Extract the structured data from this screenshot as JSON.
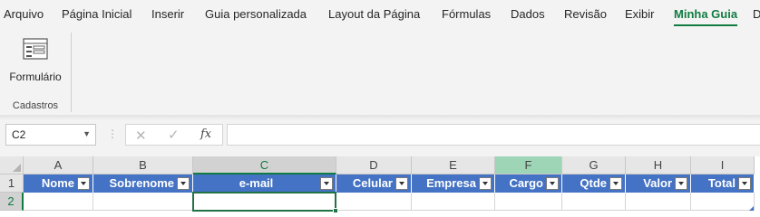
{
  "ribbon": {
    "tabs": [
      {
        "label": "Arquivo",
        "active": false
      },
      {
        "label": "Página Inicial",
        "active": false
      },
      {
        "label": "Inserir",
        "active": false
      },
      {
        "label": "Guia personalizada",
        "active": false
      },
      {
        "label": "Layout da Página",
        "active": false
      },
      {
        "label": "Fórmulas",
        "active": false
      },
      {
        "label": "Dados",
        "active": false
      },
      {
        "label": "Revisão",
        "active": false
      },
      {
        "label": "Exibir",
        "active": false
      },
      {
        "label": "Minha Guia",
        "active": true
      },
      {
        "label": "D",
        "active": false
      }
    ],
    "group": {
      "button_label": "Formulário",
      "button_icon": "form-icon",
      "label": "Cadastros"
    }
  },
  "formula_bar": {
    "name_box": "C2",
    "cancel_icon": "close-icon",
    "enter_icon": "check-icon",
    "fx_label": "fx",
    "value": ""
  },
  "sheet": {
    "columns": [
      "A",
      "B",
      "C",
      "D",
      "E",
      "F",
      "G",
      "H",
      "I"
    ],
    "rows": [
      "1",
      "2"
    ],
    "selected_cell": "C2",
    "table_headers": [
      "Nome",
      "Sobrenome",
      "e-mail",
      "Celular",
      "Empresa",
      "Cargo",
      "Qtde",
      "Valor",
      "Total"
    ]
  },
  "colors": {
    "accent": "#107c41",
    "table_header": "#4472c4",
    "selection_border": "#217346"
  }
}
